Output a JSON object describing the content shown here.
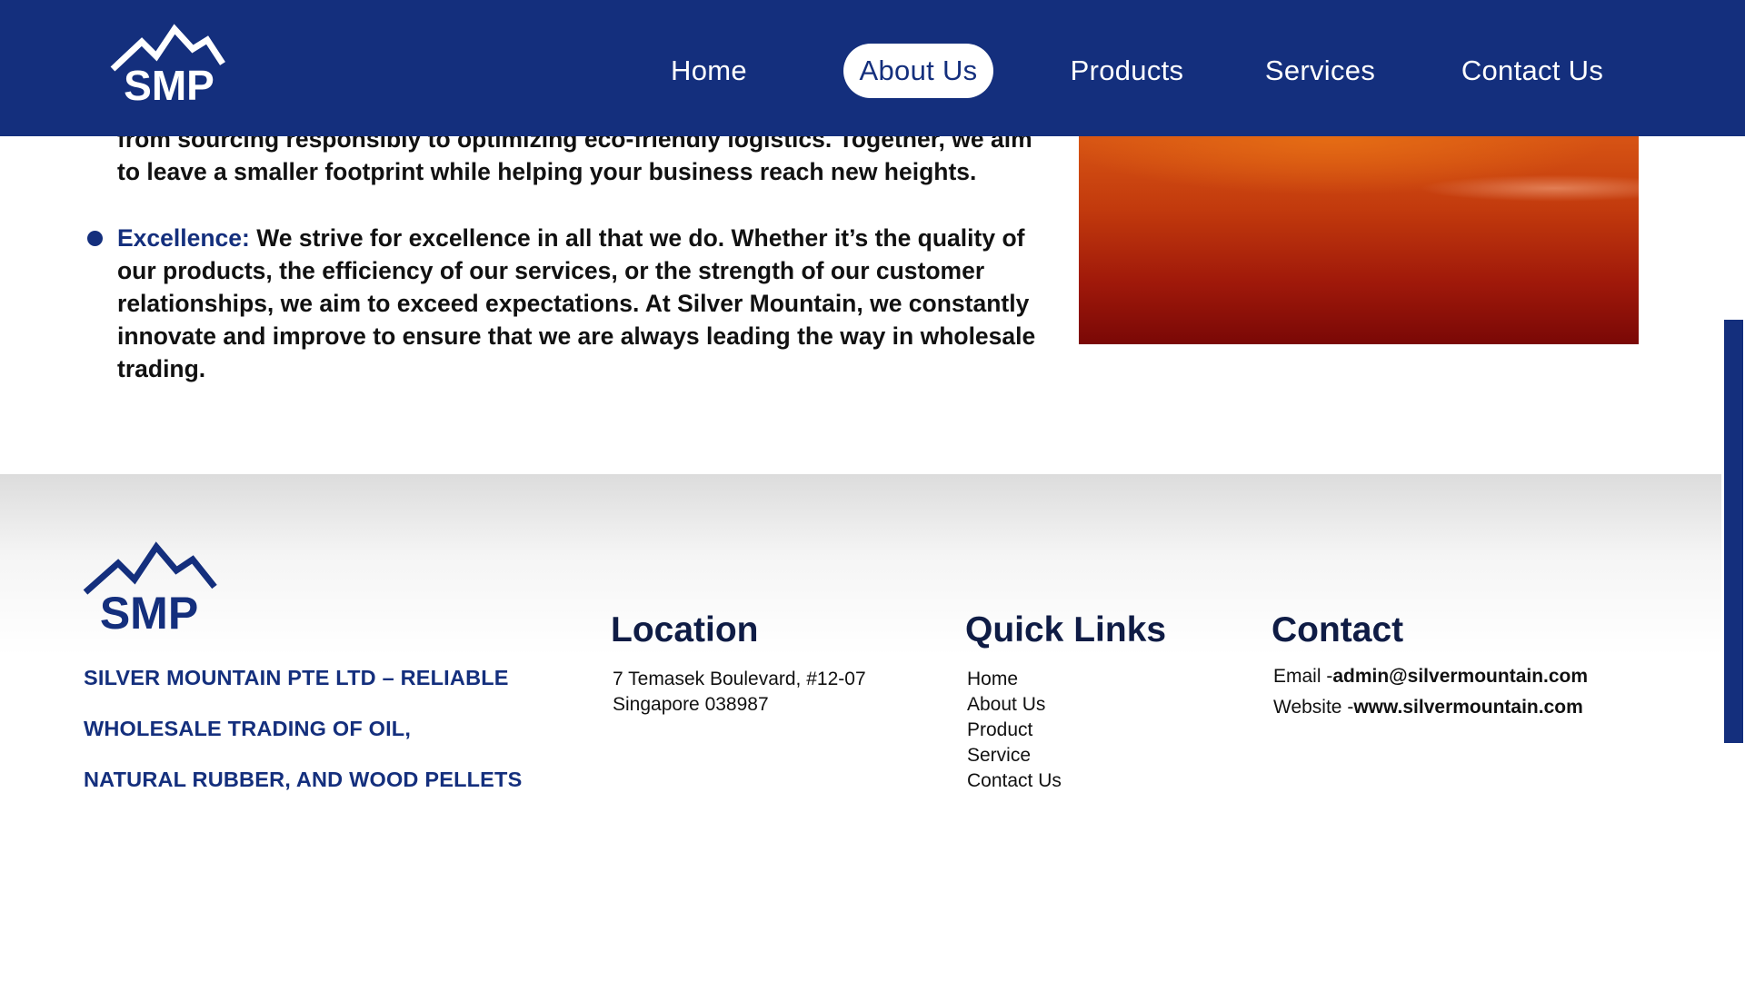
{
  "brand": {
    "logo_text": "SMP",
    "color_primary": "#142f7d",
    "color_dark": "#0f1c45"
  },
  "nav": {
    "items": [
      {
        "label": "Home",
        "active": false
      },
      {
        "label": "About Us",
        "active": true
      },
      {
        "label": "Products",
        "active": false
      },
      {
        "label": "Services",
        "active": false
      },
      {
        "label": "Contact Us",
        "active": false
      }
    ]
  },
  "content": {
    "fragment_line_1": "from sourcing responsibly to optimizing eco-friendly logistics. Together, we aim",
    "fragment_line_2": "to leave a smaller footprint while helping your business reach new heights.",
    "excellence_title": "Excellence:",
    "excellence_lines": [
      " We strive for excellence in all that we do. Whether it’s the quality of",
      "our products, the efficiency of our services, or the strength of our customer",
      "relationships, we aim to exceed expectations. At Silver Mountain, we constantly",
      "innovate and improve to ensure that we are always leading the way in wholesale",
      "trading."
    ]
  },
  "footer": {
    "tagline_lines": [
      "SILVER MOUNTAIN PTE LTD – RELIABLE",
      "WHOLESALE TRADING OF OIL,",
      "NATURAL RUBBER, AND WOOD PELLETS"
    ],
    "location": {
      "heading": "Location",
      "line1": "7 Temasek Boulevard, #12-07",
      "line2": "Singapore 038987"
    },
    "quick_links": {
      "heading": "Quick Links",
      "items": [
        "Home",
        "About Us",
        "Product",
        "Service",
        "Contact Us"
      ]
    },
    "contact": {
      "heading": "Contact",
      "email_label": "Email -",
      "email_value": "admin@silvermountain.com",
      "website_label": "Website -",
      "website_value": "www.silvermountain.com"
    }
  }
}
